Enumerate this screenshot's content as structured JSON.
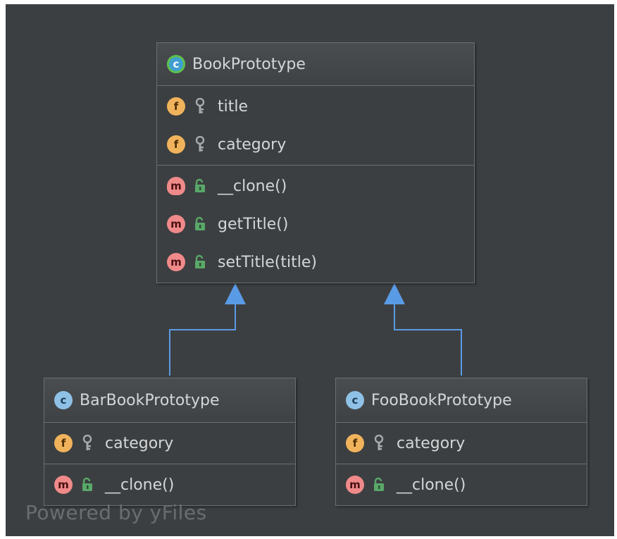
{
  "diagram": {
    "classes": [
      {
        "id": "book",
        "name": "BookPrototype",
        "kind": "c",
        "fields": [
          {
            "kind": "f",
            "name": "title"
          },
          {
            "kind": "f",
            "name": "category"
          }
        ],
        "methods": [
          {
            "kind": "m",
            "name": "__clone()"
          },
          {
            "kind": "m",
            "name": "getTitle()"
          },
          {
            "kind": "m",
            "name": "setTitle(title)"
          }
        ]
      },
      {
        "id": "bar",
        "name": "BarBookPrototype",
        "kind": "c",
        "fields": [
          {
            "kind": "f",
            "name": "category"
          }
        ],
        "methods": [
          {
            "kind": "m",
            "name": "__clone()"
          }
        ]
      },
      {
        "id": "foo",
        "name": "FooBookPrototype",
        "kind": "c",
        "fields": [
          {
            "kind": "f",
            "name": "category"
          }
        ],
        "methods": [
          {
            "kind": "m",
            "name": "__clone()"
          }
        ]
      }
    ],
    "edges": [
      {
        "from": "bar",
        "to": "book",
        "type": "inheritance"
      },
      {
        "from": "foo",
        "to": "book",
        "type": "inheritance"
      }
    ],
    "watermark": "Powered by yFiles"
  },
  "colors": {
    "background": "#3c3f41",
    "arrow": "#5a9be6",
    "field_badge": "#f0b35c",
    "method_badge": "#f08a8a",
    "class_badge": "#8fc1e6",
    "public_lock": "#59a869"
  }
}
